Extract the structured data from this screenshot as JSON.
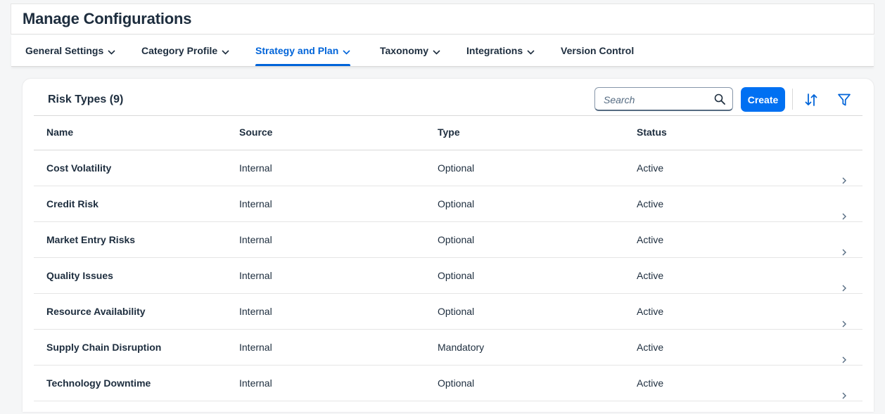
{
  "header": {
    "title": "Manage Configurations"
  },
  "tabs": [
    {
      "label": "General Settings",
      "active": false
    },
    {
      "label": "Category Profile",
      "active": false
    },
    {
      "label": "Strategy and Plan",
      "active": true
    },
    {
      "label": "Taxonomy",
      "active": false
    },
    {
      "label": "Integrations",
      "active": false
    },
    {
      "label": "Version Control",
      "active": false
    }
  ],
  "card": {
    "title": "Risk Types (9)",
    "search": {
      "placeholder": "Search",
      "value": ""
    },
    "create_label": "Create"
  },
  "table": {
    "columns": [
      "Name",
      "Source",
      "Type",
      "Status"
    ],
    "rows": [
      {
        "name": "Cost Volatility",
        "source": "Internal",
        "type": "Optional",
        "status": "Active"
      },
      {
        "name": "Credit Risk",
        "source": "Internal",
        "type": "Optional",
        "status": "Active"
      },
      {
        "name": "Market Entry Risks",
        "source": "Internal",
        "type": "Optional",
        "status": "Active"
      },
      {
        "name": "Quality Issues",
        "source": "Internal",
        "type": "Optional",
        "status": "Active"
      },
      {
        "name": "Resource Availability",
        "source": "Internal",
        "type": "Optional",
        "status": "Active"
      },
      {
        "name": "Supply Chain Disruption",
        "source": "Internal",
        "type": "Mandatory",
        "status": "Active"
      },
      {
        "name": "Technology Downtime",
        "source": "Internal",
        "type": "Optional",
        "status": "Active"
      }
    ]
  },
  "icons": {
    "tab_chevron": "chevron-down-icon",
    "search": "search-icon",
    "sort": "sort-icon",
    "filter": "filter-icon",
    "row_nav": "chevron-right-icon"
  },
  "colors": {
    "accent": "#0064d9",
    "button": "#0070f2",
    "text": "#1d2d3e"
  }
}
